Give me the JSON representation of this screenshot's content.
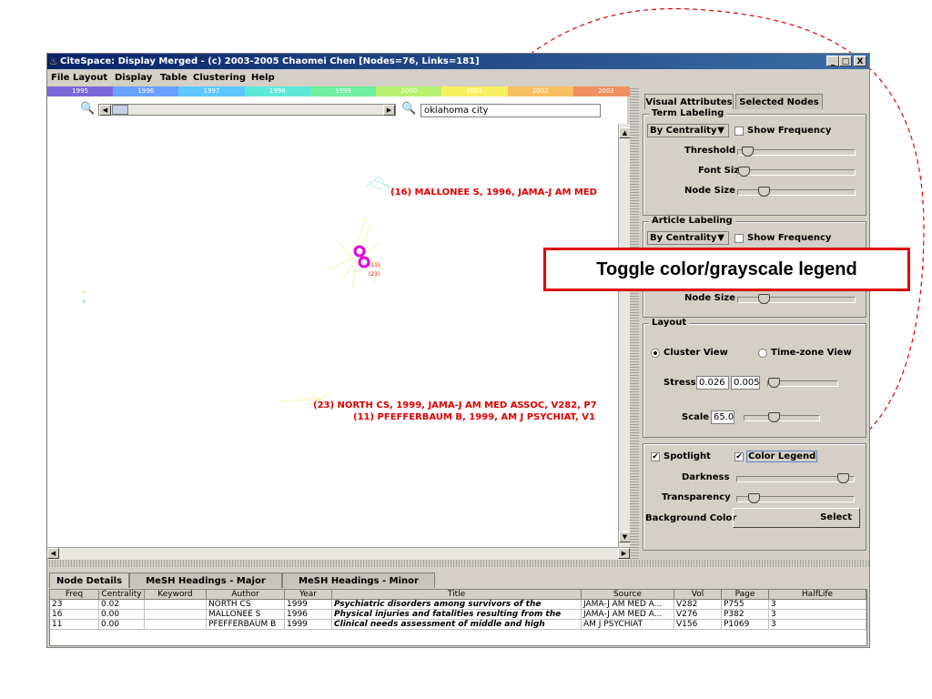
{
  "window": {
    "title": "CiteSpace: Display Merged - (c) 2003-2005 Chaomei Chen [Nodes=76, Links=181]",
    "buttons": [
      "_",
      "□",
      "X"
    ]
  },
  "menu": [
    "File",
    "Layout",
    "Display",
    "Table",
    "Clustering",
    "Help"
  ],
  "timeline": {
    "years": [
      "1995",
      "1996",
      "1997",
      "1998",
      "1999",
      "2000",
      "2001",
      "2002",
      "2003"
    ],
    "colors": [
      "#7b68d8",
      "#6aa0ff",
      "#5cc8ff",
      "#5ee8d8",
      "#6ef0a0",
      "#b8f070",
      "#f8f060",
      "#f8c060",
      "#f09060"
    ]
  },
  "toolbar": {
    "search_value": "oklahoma city"
  },
  "canvas": {
    "labels": [
      "(16) MALLONEE S, 1996, JAMA-J AM MED",
      "(23) NORTH CS, 1999, JAMA-J AM MED ASSOC, V282, P7",
      "(11) PFEFFERBAUM B, 1999, AM J PSYCHIAT, V1"
    ],
    "small_labels": [
      "(11)",
      "(23)"
    ]
  },
  "panel": {
    "tabs": [
      "Visual Attributes",
      "Selected Nodes"
    ],
    "term_labeling": {
      "title": "Term Labeling",
      "mode": "By Centrality",
      "show_frequency": "Show Frequency",
      "threshold": "Threshold",
      "font_size": "Font Size",
      "node_size": "Node Size"
    },
    "article_labeling": {
      "title": "Article Labeling",
      "mode": "By Centrality",
      "show_frequency": "Show Frequency",
      "node_size": "Node Size"
    },
    "layout": {
      "title": "Layout",
      "cluster_view": "Cluster View",
      "timezone_view": "Time-zone View",
      "stress_label": "Stress",
      "stress_a": "0.026",
      "stress_b": "0.005",
      "scale_label": "Scale",
      "scale_value": "65.0"
    },
    "spotlight": {
      "spotlight_label": "Spotlight",
      "color_legend_label": "Color Legend",
      "darkness": "Darkness",
      "transparency": "Transparency",
      "background_color": "Background Color",
      "select": "Select"
    }
  },
  "callout": "Toggle color/grayscale legend",
  "bottom_tabs": [
    "Node Details",
    "MeSH Headings - Major Topics",
    "MeSH Headings - Minor Topics"
  ],
  "table": {
    "columns": [
      "Freq",
      "Centrality",
      "Keyword",
      "Author",
      "Year",
      "Title",
      "Source",
      "Vol",
      "Page",
      "HalfLife"
    ],
    "rows": [
      [
        "23",
        "0.02",
        "",
        "NORTH CS",
        "1999",
        "Psychiatric disorders among survivors of the",
        "JAMA-J AM MED A...",
        "V282",
        "P755",
        "3"
      ],
      [
        "16",
        "0.00",
        "",
        "MALLONEE S",
        "1996",
        "Physical injuries and fatalities resulting from the",
        "JAMA-J AM MED A...",
        "V276",
        "P382",
        "3"
      ],
      [
        "11",
        "0.00",
        "",
        "PFEFFERBAUM B",
        "1999",
        "Clinical needs assessment of middle and high",
        "AM J PSYCHIAT",
        "V156",
        "P1069",
        "3"
      ]
    ]
  }
}
